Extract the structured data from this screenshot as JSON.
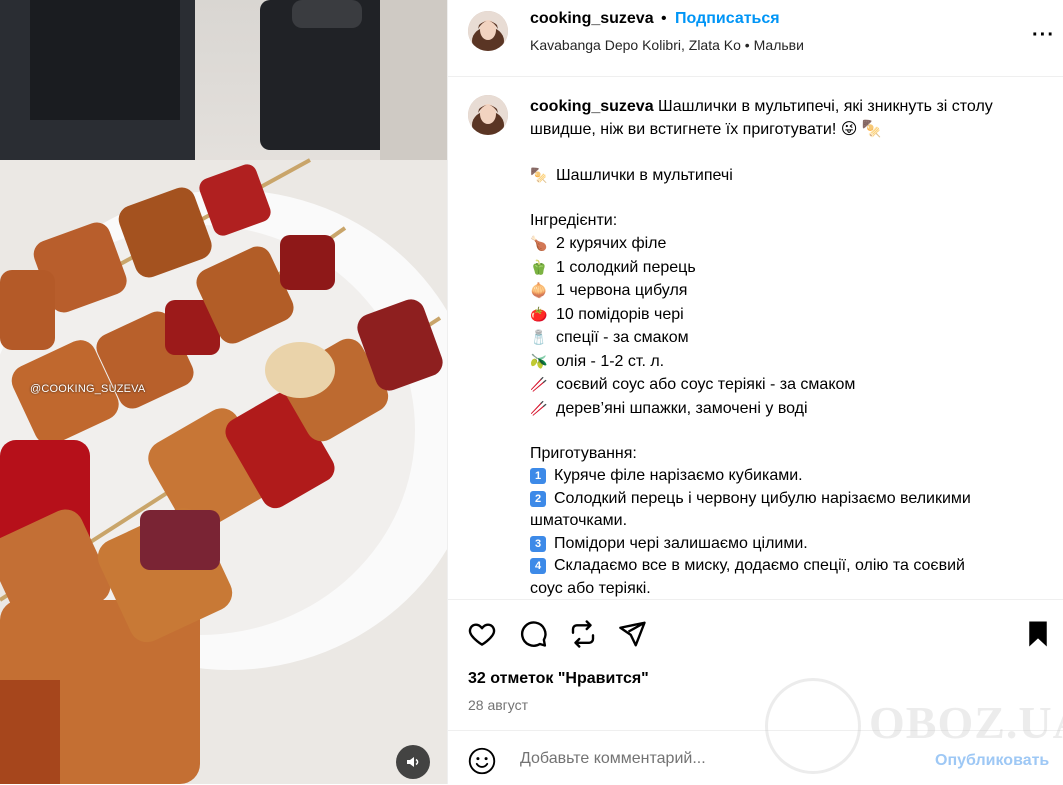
{
  "media": {
    "watermark": "@COOKING_SUZEVA",
    "sound_icon": "speaker-icon"
  },
  "header": {
    "username": "cooking_suzeva",
    "separator": "•",
    "follow_label": "Подписаться",
    "location": "Kavabanga Depo Kolibri, Zlata Ko • Мальви"
  },
  "caption": {
    "username": "cooking_suzeva",
    "intro_line1": " Шашлички в мультипечі, які зникнуть зі столу",
    "intro_line2": "швидше, ніж ви встигнете їх приготувати! 😜 🍢",
    "subtitle_emoji": "🍢",
    "subtitle": "Шашлички в мультипечі",
    "ingredients_title": "Інгредієнти:",
    "ingredients": [
      {
        "emoji": "🍗",
        "text": "2 курячих філе"
      },
      {
        "emoji": "🫑",
        "text": "1 солодкий перець"
      },
      {
        "emoji": "🧅",
        "text": "1 червона цибуля"
      },
      {
        "emoji": "🍅",
        "text": "10 помідорів чері"
      },
      {
        "emoji": "🧂",
        "text": "спеції - за смаком"
      },
      {
        "emoji": "🫒",
        "text": "олія - 1-2 ст. л."
      },
      {
        "emoji": "🥢",
        "text": "соєвий соус або соус теріякі - за смаком"
      },
      {
        "emoji": "🥢",
        "text": "дерев’яні шпажки, замочені у воді"
      }
    ],
    "steps_title": "Приготування:",
    "steps": [
      {
        "num": "1",
        "line1": "Куряче філе нарізаємо кубиками.",
        "line2": ""
      },
      {
        "num": "2",
        "line1": "Солодкий перець і червону цибулю нарізаємо великими",
        "line2": "шматочками."
      },
      {
        "num": "3",
        "line1": "Помідори чері залишаємо цілими.",
        "line2": ""
      },
      {
        "num": "4",
        "line1": "Складаємо все в миску, додаємо спеції, олію та соєвий",
        "line2": "соус або теріякі."
      }
    ]
  },
  "actions": {
    "likes": "32 отметок \"Нравится\"",
    "date": "28 август"
  },
  "comment": {
    "placeholder": "Добавьте комментарий...",
    "publish_label": "Опубликовать"
  },
  "watermark_site": "OBOZ.UA"
}
